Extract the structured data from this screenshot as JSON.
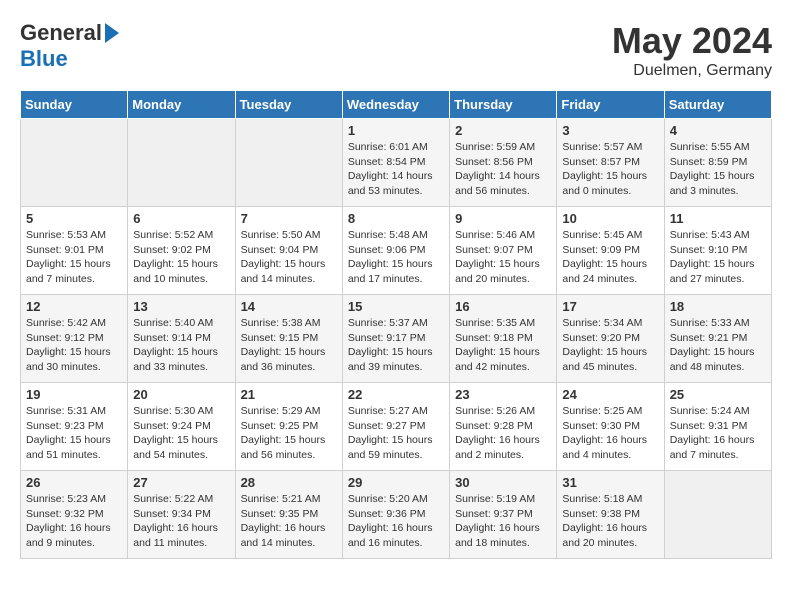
{
  "logo": {
    "general_text": "General",
    "blue_text": "Blue"
  },
  "title": "May 2024",
  "subtitle": "Duelmen, Germany",
  "days_of_week": [
    "Sunday",
    "Monday",
    "Tuesday",
    "Wednesday",
    "Thursday",
    "Friday",
    "Saturday"
  ],
  "weeks": [
    [
      {
        "day": "",
        "info": ""
      },
      {
        "day": "",
        "info": ""
      },
      {
        "day": "",
        "info": ""
      },
      {
        "day": "1",
        "info": "Sunrise: 6:01 AM\nSunset: 8:54 PM\nDaylight: 14 hours\nand 53 minutes."
      },
      {
        "day": "2",
        "info": "Sunrise: 5:59 AM\nSunset: 8:56 PM\nDaylight: 14 hours\nand 56 minutes."
      },
      {
        "day": "3",
        "info": "Sunrise: 5:57 AM\nSunset: 8:57 PM\nDaylight: 15 hours\nand 0 minutes."
      },
      {
        "day": "4",
        "info": "Sunrise: 5:55 AM\nSunset: 8:59 PM\nDaylight: 15 hours\nand 3 minutes."
      }
    ],
    [
      {
        "day": "5",
        "info": "Sunrise: 5:53 AM\nSunset: 9:01 PM\nDaylight: 15 hours\nand 7 minutes."
      },
      {
        "day": "6",
        "info": "Sunrise: 5:52 AM\nSunset: 9:02 PM\nDaylight: 15 hours\nand 10 minutes."
      },
      {
        "day": "7",
        "info": "Sunrise: 5:50 AM\nSunset: 9:04 PM\nDaylight: 15 hours\nand 14 minutes."
      },
      {
        "day": "8",
        "info": "Sunrise: 5:48 AM\nSunset: 9:06 PM\nDaylight: 15 hours\nand 17 minutes."
      },
      {
        "day": "9",
        "info": "Sunrise: 5:46 AM\nSunset: 9:07 PM\nDaylight: 15 hours\nand 20 minutes."
      },
      {
        "day": "10",
        "info": "Sunrise: 5:45 AM\nSunset: 9:09 PM\nDaylight: 15 hours\nand 24 minutes."
      },
      {
        "day": "11",
        "info": "Sunrise: 5:43 AM\nSunset: 9:10 PM\nDaylight: 15 hours\nand 27 minutes."
      }
    ],
    [
      {
        "day": "12",
        "info": "Sunrise: 5:42 AM\nSunset: 9:12 PM\nDaylight: 15 hours\nand 30 minutes."
      },
      {
        "day": "13",
        "info": "Sunrise: 5:40 AM\nSunset: 9:14 PM\nDaylight: 15 hours\nand 33 minutes."
      },
      {
        "day": "14",
        "info": "Sunrise: 5:38 AM\nSunset: 9:15 PM\nDaylight: 15 hours\nand 36 minutes."
      },
      {
        "day": "15",
        "info": "Sunrise: 5:37 AM\nSunset: 9:17 PM\nDaylight: 15 hours\nand 39 minutes."
      },
      {
        "day": "16",
        "info": "Sunrise: 5:35 AM\nSunset: 9:18 PM\nDaylight: 15 hours\nand 42 minutes."
      },
      {
        "day": "17",
        "info": "Sunrise: 5:34 AM\nSunset: 9:20 PM\nDaylight: 15 hours\nand 45 minutes."
      },
      {
        "day": "18",
        "info": "Sunrise: 5:33 AM\nSunset: 9:21 PM\nDaylight: 15 hours\nand 48 minutes."
      }
    ],
    [
      {
        "day": "19",
        "info": "Sunrise: 5:31 AM\nSunset: 9:23 PM\nDaylight: 15 hours\nand 51 minutes."
      },
      {
        "day": "20",
        "info": "Sunrise: 5:30 AM\nSunset: 9:24 PM\nDaylight: 15 hours\nand 54 minutes."
      },
      {
        "day": "21",
        "info": "Sunrise: 5:29 AM\nSunset: 9:25 PM\nDaylight: 15 hours\nand 56 minutes."
      },
      {
        "day": "22",
        "info": "Sunrise: 5:27 AM\nSunset: 9:27 PM\nDaylight: 15 hours\nand 59 minutes."
      },
      {
        "day": "23",
        "info": "Sunrise: 5:26 AM\nSunset: 9:28 PM\nDaylight: 16 hours\nand 2 minutes."
      },
      {
        "day": "24",
        "info": "Sunrise: 5:25 AM\nSunset: 9:30 PM\nDaylight: 16 hours\nand 4 minutes."
      },
      {
        "day": "25",
        "info": "Sunrise: 5:24 AM\nSunset: 9:31 PM\nDaylight: 16 hours\nand 7 minutes."
      }
    ],
    [
      {
        "day": "26",
        "info": "Sunrise: 5:23 AM\nSunset: 9:32 PM\nDaylight: 16 hours\nand 9 minutes."
      },
      {
        "day": "27",
        "info": "Sunrise: 5:22 AM\nSunset: 9:34 PM\nDaylight: 16 hours\nand 11 minutes."
      },
      {
        "day": "28",
        "info": "Sunrise: 5:21 AM\nSunset: 9:35 PM\nDaylight: 16 hours\nand 14 minutes."
      },
      {
        "day": "29",
        "info": "Sunrise: 5:20 AM\nSunset: 9:36 PM\nDaylight: 16 hours\nand 16 minutes."
      },
      {
        "day": "30",
        "info": "Sunrise: 5:19 AM\nSunset: 9:37 PM\nDaylight: 16 hours\nand 18 minutes."
      },
      {
        "day": "31",
        "info": "Sunrise: 5:18 AM\nSunset: 9:38 PM\nDaylight: 16 hours\nand 20 minutes."
      },
      {
        "day": "",
        "info": ""
      }
    ]
  ]
}
